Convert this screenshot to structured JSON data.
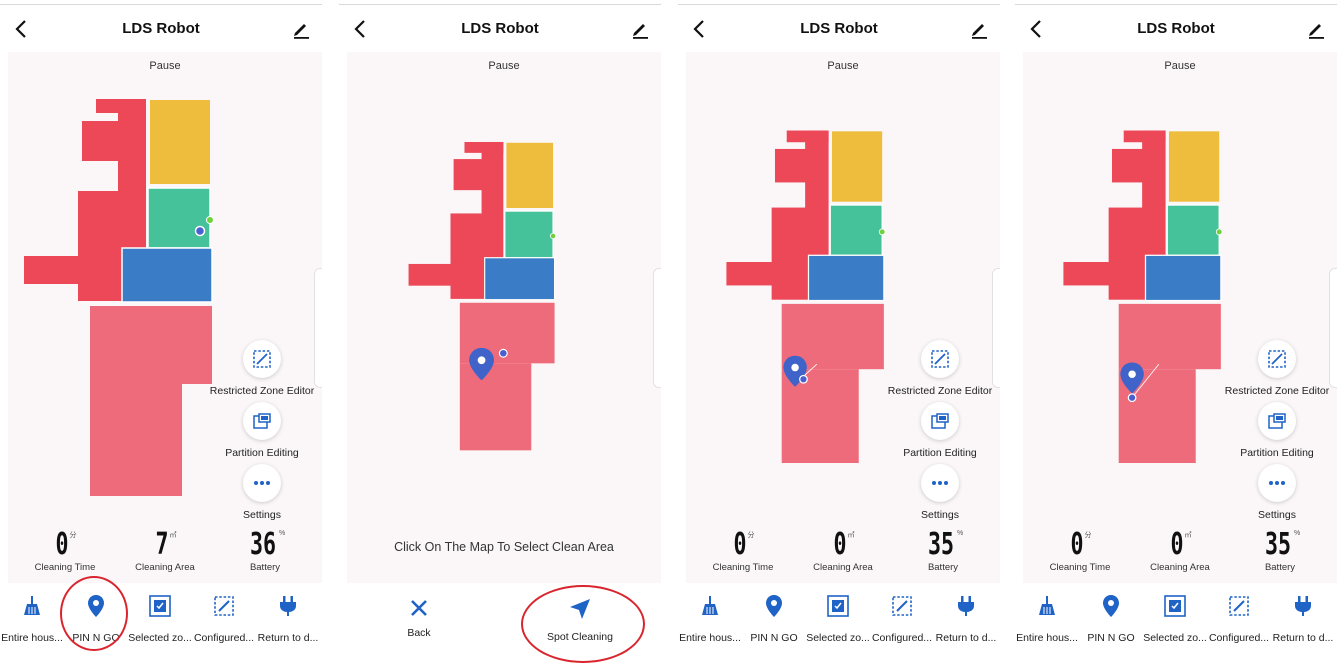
{
  "header": {
    "title": "LDS Robot"
  },
  "status": "Pause",
  "tools": {
    "restricted": "Restricted Zone Editor",
    "partition": "Partition Editing",
    "settings": "Settings"
  },
  "stat_labels": {
    "time": "Cleaning Time",
    "area": "Cleaning Area",
    "battery": "Battery"
  },
  "stat_units": {
    "time": "分",
    "area": "㎡",
    "battery": "%"
  },
  "screens": [
    {
      "stats": {
        "time": "0",
        "area": "7",
        "battery": "36"
      }
    },
    {
      "hint": "Click On The Map To Select Clean Area",
      "back": "Back",
      "spot": "Spot Cleaning"
    },
    {
      "stats": {
        "time": "0",
        "area": "0",
        "battery": "35"
      }
    },
    {
      "stats": {
        "time": "0",
        "area": "0",
        "battery": "35"
      }
    }
  ],
  "nav": [
    "Entire hous...",
    "PIN N GO",
    "Selected zo...",
    "Configured...",
    "Return to d..."
  ],
  "colors": {
    "accent": "#1f63c6",
    "room_red": "#ec4858",
    "room_pink": "#ee6b7b",
    "room_yellow": "#eebd3d",
    "room_green": "#46c29a",
    "room_blue": "#3a7cc6",
    "annotation": "#d9262e"
  }
}
